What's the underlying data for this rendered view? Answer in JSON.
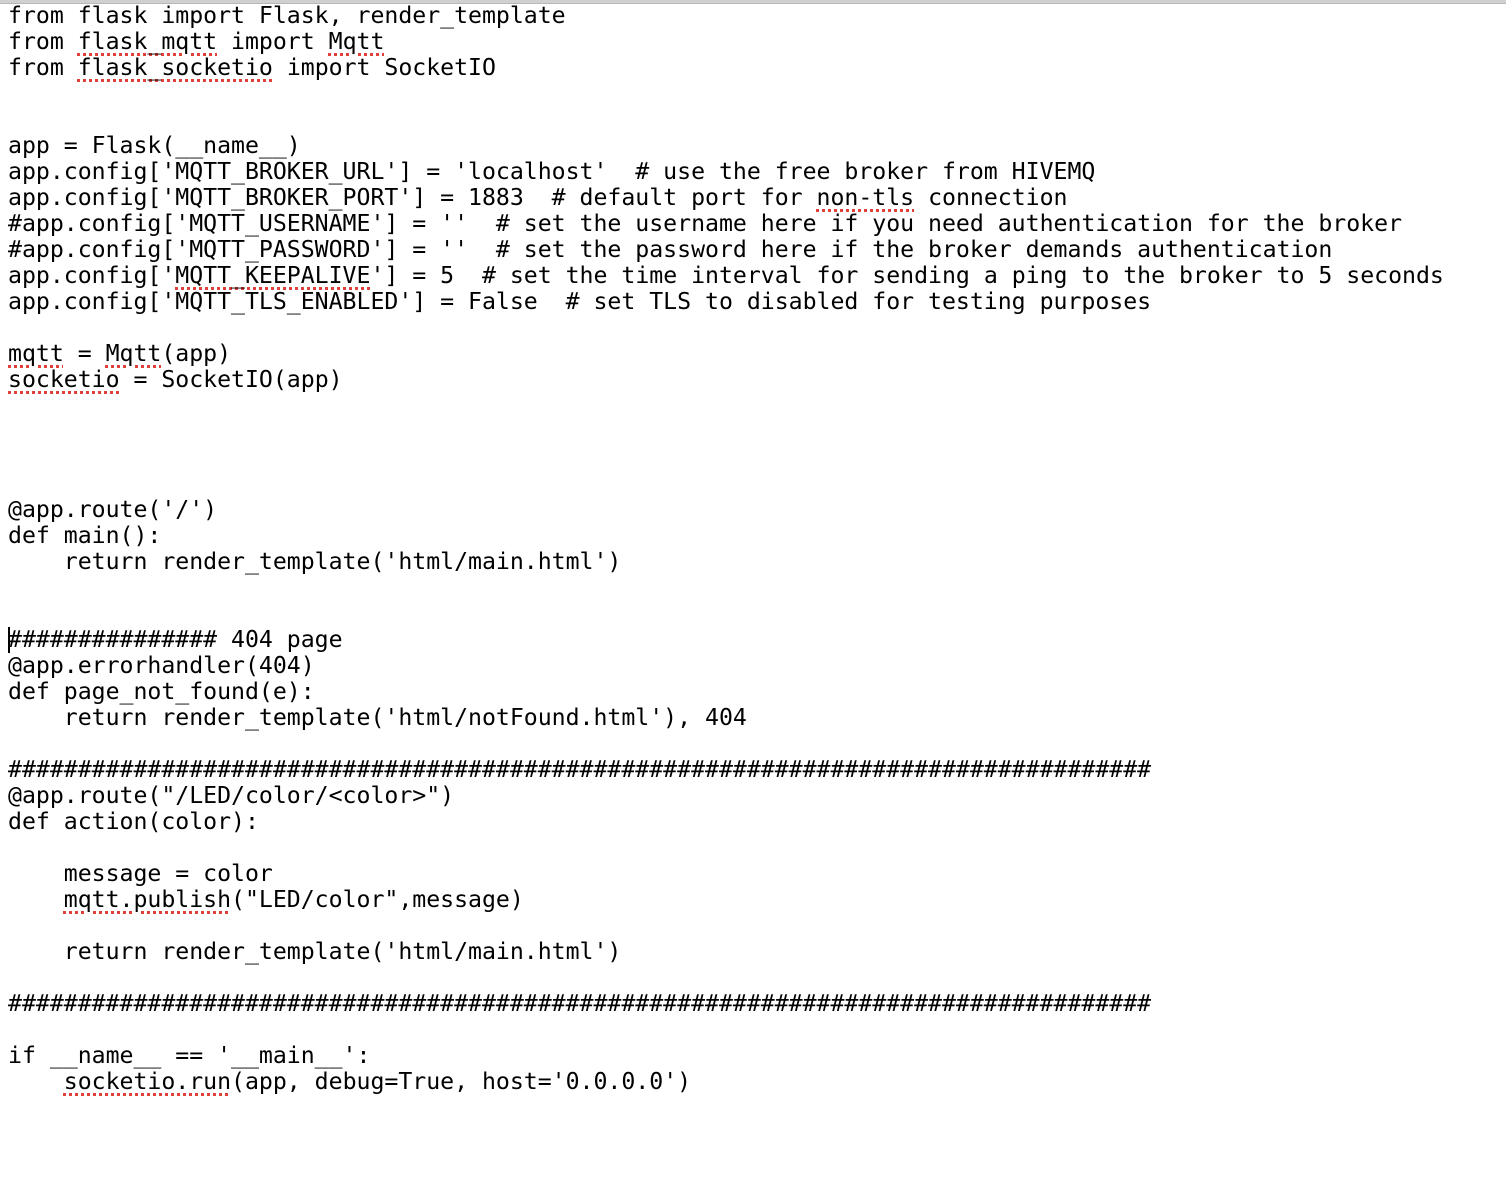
{
  "editor": {
    "language": "python",
    "caret_line": 24,
    "lines": [
      {
        "segments": [
          {
            "t": "from flask import Flask, render_template"
          }
        ]
      },
      {
        "segments": [
          {
            "t": "from "
          },
          {
            "t": "flask_mqtt",
            "spell": true
          },
          {
            "t": " import "
          },
          {
            "t": "Mqtt",
            "spell": true
          }
        ]
      },
      {
        "segments": [
          {
            "t": "from "
          },
          {
            "t": "flask_socketio",
            "spell": true
          },
          {
            "t": " import SocketIO"
          }
        ]
      },
      {
        "segments": [
          {
            "t": ""
          }
        ]
      },
      {
        "segments": [
          {
            "t": ""
          }
        ]
      },
      {
        "segments": [
          {
            "t": "app = Flask(__name__)"
          }
        ]
      },
      {
        "segments": [
          {
            "t": "app.config['MQTT_BROKER_URL'] = 'localhost'  # use the free broker from HIVEMQ"
          }
        ]
      },
      {
        "segments": [
          {
            "t": "app.config['MQTT_BROKER_PORT'] = 1883  # default port for "
          },
          {
            "t": "non-tls",
            "spell": true
          },
          {
            "t": " connection"
          }
        ]
      },
      {
        "segments": [
          {
            "t": "#app.config['MQTT_USERNAME'] = ''  # set the username here if you need authentication for the broker"
          }
        ]
      },
      {
        "segments": [
          {
            "t": "#app.config['MQTT_PASSWORD'] = ''  # set the password here if the broker demands authentication"
          }
        ]
      },
      {
        "segments": [
          {
            "t": "app.config['"
          },
          {
            "t": "MQTT_KEEPALIVE",
            "spell": true
          },
          {
            "t": "'] = 5  # set the time interval for sending a ping to the broker to 5 seconds"
          }
        ]
      },
      {
        "segments": [
          {
            "t": "app.config['MQTT_TLS_ENABLED'] = False  # set TLS to disabled for testing purposes"
          }
        ]
      },
      {
        "segments": [
          {
            "t": ""
          }
        ]
      },
      {
        "segments": [
          {
            "t": "mqtt",
            "spell": true
          },
          {
            "t": " = "
          },
          {
            "t": "Mqtt",
            "spell": true
          },
          {
            "t": "(app)"
          }
        ]
      },
      {
        "segments": [
          {
            "t": "socketio",
            "spell": true
          },
          {
            "t": " = SocketIO(app)"
          }
        ]
      },
      {
        "segments": [
          {
            "t": ""
          }
        ]
      },
      {
        "segments": [
          {
            "t": ""
          }
        ]
      },
      {
        "segments": [
          {
            "t": ""
          }
        ]
      },
      {
        "segments": [
          {
            "t": ""
          }
        ]
      },
      {
        "segments": [
          {
            "t": "@app.route('/')"
          }
        ]
      },
      {
        "segments": [
          {
            "t": "def main():"
          }
        ]
      },
      {
        "segments": [
          {
            "t": "    return render_template('html/main.html')"
          }
        ]
      },
      {
        "segments": [
          {
            "t": ""
          }
        ]
      },
      {
        "segments": [
          {
            "t": ""
          }
        ]
      },
      {
        "segments": [
          {
            "t": "############### 404 page"
          }
        ]
      },
      {
        "segments": [
          {
            "t": "@app.errorhandler(404)"
          }
        ]
      },
      {
        "segments": [
          {
            "t": "def page_not_found(e):"
          }
        ]
      },
      {
        "segments": [
          {
            "t": "    return render_template('html/notFound.html'), 404"
          }
        ]
      },
      {
        "segments": [
          {
            "t": ""
          }
        ]
      },
      {
        "segments": [
          {
            "t": "##################################################################################"
          }
        ]
      },
      {
        "segments": [
          {
            "t": "@app.route(\"/LED/color/<color>\")"
          }
        ]
      },
      {
        "segments": [
          {
            "t": "def action(color):"
          }
        ]
      },
      {
        "segments": [
          {
            "t": ""
          }
        ]
      },
      {
        "segments": [
          {
            "t": "    message = color"
          }
        ]
      },
      {
        "segments": [
          {
            "t": "    "
          },
          {
            "t": "mqtt.publish",
            "spell": true
          },
          {
            "t": "(\"LED/color\",message)"
          }
        ]
      },
      {
        "segments": [
          {
            "t": ""
          }
        ]
      },
      {
        "segments": [
          {
            "t": "    return render_template('html/main.html')"
          }
        ]
      },
      {
        "segments": [
          {
            "t": ""
          }
        ]
      },
      {
        "segments": [
          {
            "t": "##################################################################################"
          }
        ]
      },
      {
        "segments": [
          {
            "t": ""
          }
        ]
      },
      {
        "segments": [
          {
            "t": "if __name__ == '__main__':"
          }
        ]
      },
      {
        "segments": [
          {
            "t": "    "
          },
          {
            "t": "socketio.run",
            "spell": true
          },
          {
            "t": "(app, debug=True, host='0.0.0.0')"
          }
        ]
      }
    ]
  }
}
